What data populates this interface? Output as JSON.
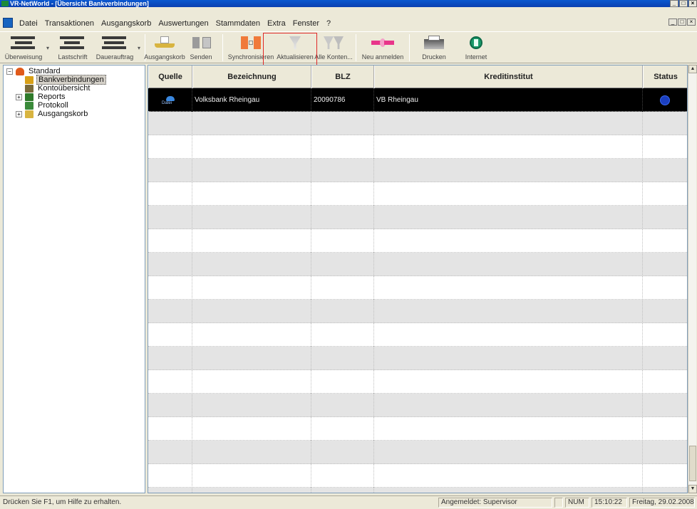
{
  "window": {
    "title": "VR-NetWorld - [Übersicht Bankverbindungen]"
  },
  "menu": [
    "Datei",
    "Transaktionen",
    "Ausgangskorb",
    "Auswertungen",
    "Stammdaten",
    "Extra",
    "Fenster",
    "?"
  ],
  "toolbar": {
    "buttons": [
      {
        "label": "Überweisung",
        "icon": "transfer-icon"
      },
      {
        "label": "Lastschrift",
        "icon": "debit-icon"
      },
      {
        "label": "Dauerauftrag",
        "icon": "standing-order-icon"
      },
      {
        "label": "Ausgangskorb",
        "icon": "outbox-basket-icon"
      },
      {
        "label": "Senden",
        "icon": "send-icon"
      },
      {
        "label": "Synchronisieren",
        "icon": "synchronize-icon"
      },
      {
        "label": "Aktualisieren",
        "icon": "refresh-funnel-icon"
      },
      {
        "label": "Alle Konten...",
        "icon": "all-accounts-icon"
      },
      {
        "label": "Neu anmelden",
        "icon": "relogin-icon"
      },
      {
        "label": "Drucken",
        "icon": "print-icon"
      },
      {
        "label": "Internet",
        "icon": "internet-icon"
      }
    ],
    "highlight_color": "#e02828"
  },
  "tree": {
    "items": [
      {
        "label": "Standard",
        "level": 0,
        "toggle": "−",
        "icon": "user-icon"
      },
      {
        "label": "Bankverbindungen",
        "level": 1,
        "toggle": "",
        "icon": "bank-icon",
        "selected": true
      },
      {
        "label": "Kontoübersicht",
        "level": 1,
        "toggle": "",
        "icon": "folder-icon"
      },
      {
        "label": "Reports",
        "level": 1,
        "toggle": "+",
        "icon": "report-icon"
      },
      {
        "label": "Protokoll",
        "level": 1,
        "toggle": "",
        "icon": "protocol-icon"
      },
      {
        "label": "Ausgangskorb",
        "level": 1,
        "toggle": "+",
        "icon": "basket-icon"
      }
    ]
  },
  "table": {
    "columns": [
      "Quelle",
      "Bezeichnung",
      "BLZ",
      "Kreditinstitut",
      "Status"
    ],
    "rows": [
      {
        "quelle": "Datei",
        "bezeichnung": "Volksbank Rheingau",
        "blz": "20090786",
        "kreditinstitut": "VB Rheingau",
        "status": "online",
        "selected": true
      }
    ],
    "empty_rows": 17
  },
  "statusbar": {
    "hint": "Drücken Sie F1, um Hilfe zu erhalten.",
    "user": "Angemeldet: Supervisor",
    "num": "NUM",
    "time": "15:10:22",
    "date": "Freitag, 29.02.2008"
  },
  "colors": {
    "selection": "#000000",
    "status_online": "#1b3fc0",
    "title_bar": "#0a58d0"
  }
}
